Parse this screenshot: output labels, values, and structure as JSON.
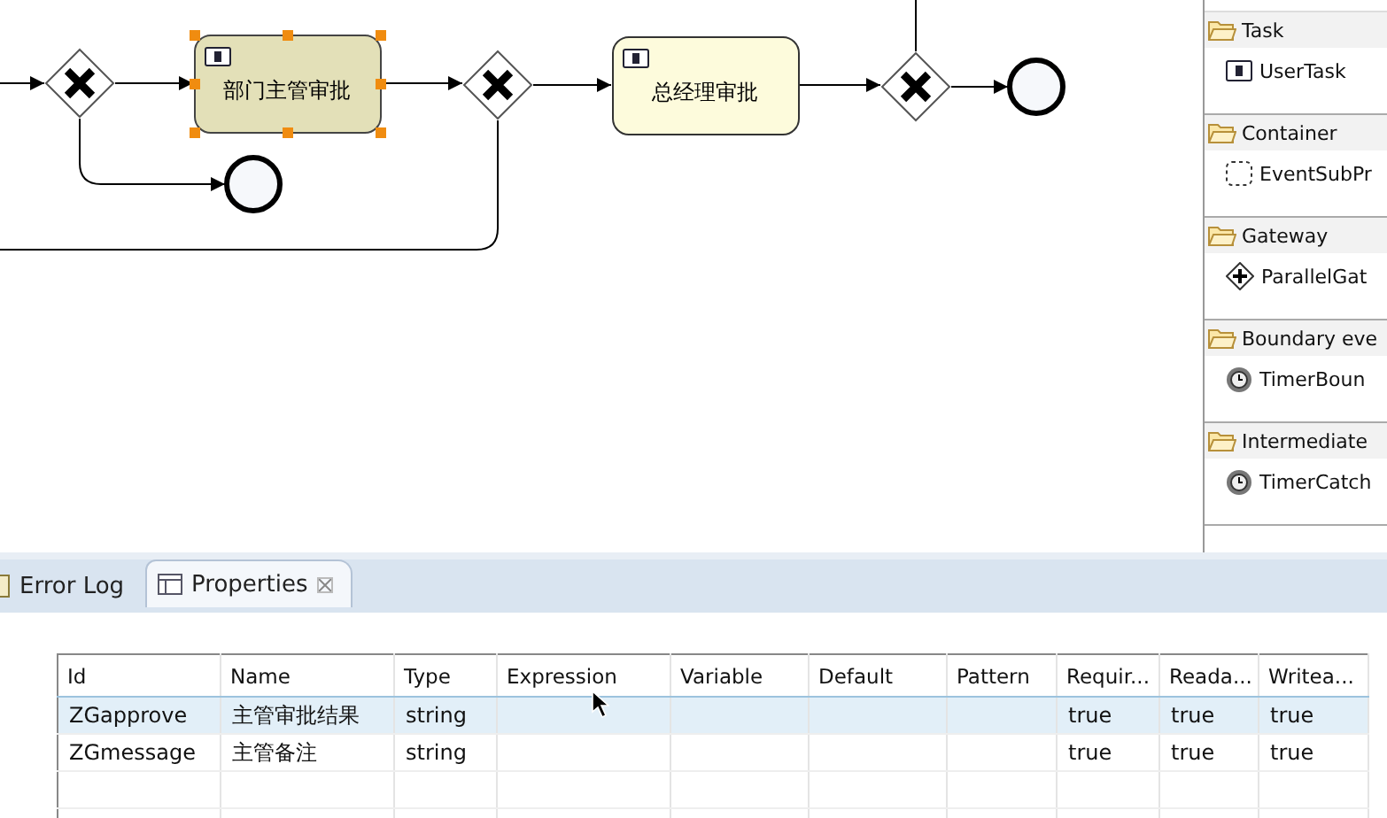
{
  "diagram": {
    "tasks": [
      {
        "label": "部门主管审批",
        "selected": true
      },
      {
        "label": "总经理审批",
        "selected": false
      }
    ]
  },
  "palette": {
    "groups": [
      {
        "header": "Task",
        "items": [
          {
            "label": "UserTask",
            "kind": "task"
          }
        ]
      },
      {
        "header": "Container",
        "items": [
          {
            "label": "EventSubPr",
            "kind": "subprocess"
          }
        ]
      },
      {
        "header": "Gateway",
        "items": [
          {
            "label": "ParallelGat",
            "kind": "gateway"
          }
        ]
      },
      {
        "header": "Boundary eve",
        "items": [
          {
            "label": "TimerBoun",
            "kind": "timer"
          }
        ]
      },
      {
        "header": "Intermediate",
        "items": [
          {
            "label": "TimerCatch",
            "kind": "timer"
          }
        ]
      }
    ]
  },
  "tabs": [
    {
      "label": "Error Log",
      "selected": false
    },
    {
      "label": "Properties",
      "selected": true
    }
  ],
  "table": {
    "columns": [
      "Id",
      "Name",
      "Type",
      "Expression",
      "Variable",
      "Default",
      "Pattern",
      "Requir...",
      "Reada...",
      "Writea..."
    ],
    "rows": [
      {
        "selected": true,
        "cells": [
          "ZGapprove",
          "主管审批结果",
          "string",
          "",
          "",
          "",
          "",
          "true",
          "true",
          "true"
        ]
      },
      {
        "selected": false,
        "cells": [
          "ZGmessage",
          "主管备注",
          "string",
          "",
          "",
          "",
          "",
          "true",
          "true",
          "true"
        ]
      }
    ]
  }
}
